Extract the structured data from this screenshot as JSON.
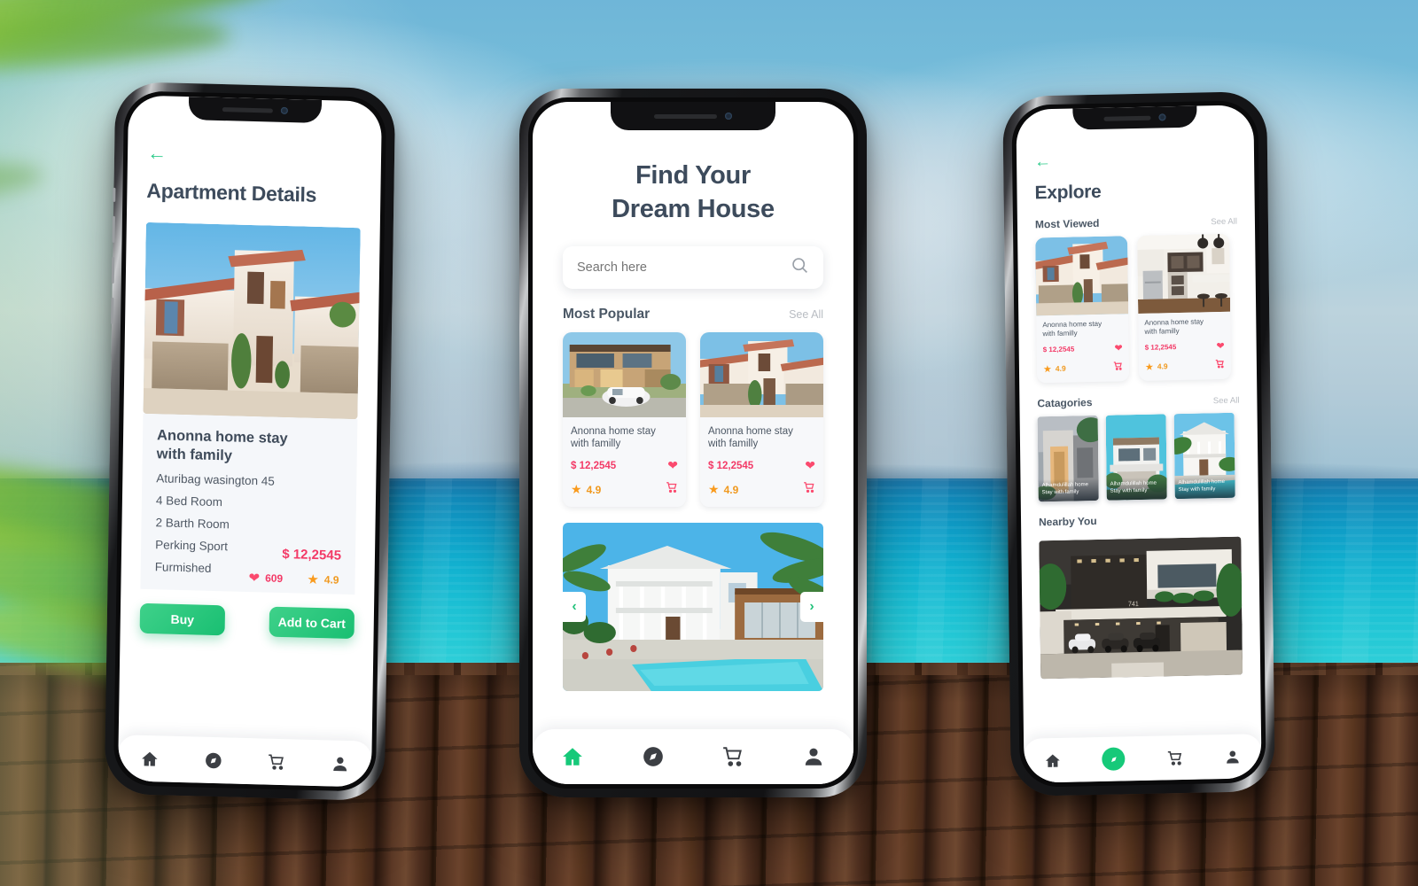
{
  "scene": {
    "background": "beach-deck-photo",
    "colors": {
      "sky": "#8cc5dc",
      "sea": "#12b2d0",
      "deck": "#4b2d1d",
      "accent_green": "#16c979",
      "price_pink": "#f33a67",
      "star_orange": "#f99a1c"
    }
  },
  "phone1": {
    "back_icon": "←",
    "title": "Apartment Details",
    "hero_image": "two-story-spanish-house-with-garages",
    "listing": {
      "name": "Anonna home stay\nwith family",
      "address": "Aturibag wasington 45",
      "features": [
        "4 Bed Room",
        "2 Barth Room",
        "Perking Sport",
        "Furmished"
      ],
      "price": "$ 12,2545",
      "likes": "609",
      "rating": "4.9"
    },
    "buy_label": "Buy",
    "cart_label": "Add to Cart",
    "nav": [
      {
        "icon": "home-icon",
        "active": false
      },
      {
        "icon": "compass-icon",
        "active": false
      },
      {
        "icon": "cart-icon",
        "active": false
      },
      {
        "icon": "person-icon",
        "active": false
      }
    ]
  },
  "phone2": {
    "title_line1": "Find Your",
    "title_line2": "Dream House",
    "search": {
      "placeholder": "Search here",
      "value": "",
      "icon": "search-icon"
    },
    "section": {
      "title": "Most Popular",
      "see_all": "See All"
    },
    "cards": [
      {
        "image": "modern-house-with-white-car",
        "name": "Anonna home stay\nwith familly",
        "price": "$ 12,2545",
        "rating": "4.9",
        "heart_icon": "heart-icon",
        "cart_icon": "cart-icon",
        "star_icon": "star-icon"
      },
      {
        "image": "spanish-house-with-garages",
        "name": "Anonna home stay\nwith familly",
        "price": "$ 12,2545",
        "rating": "4.9",
        "heart_icon": "heart-icon",
        "cart_icon": "cart-icon",
        "star_icon": "star-icon"
      }
    ],
    "carousel": {
      "image": "white-villa-with-pool-and-palms",
      "prev": "‹",
      "next": "›"
    },
    "nav": [
      {
        "icon": "home-icon",
        "active": true
      },
      {
        "icon": "compass-icon",
        "active": false
      },
      {
        "icon": "cart-icon",
        "active": false
      },
      {
        "icon": "person-icon",
        "active": false
      }
    ]
  },
  "phone3": {
    "back_icon": "←",
    "title": "Explore",
    "sections": [
      {
        "title": "Most Viewed",
        "see_all": "See All"
      },
      {
        "title": "Catagories",
        "see_all": "See All"
      },
      {
        "title": "Nearby You",
        "see_all": ""
      }
    ],
    "most_viewed": [
      {
        "image": "spanish-house-exterior",
        "name": "Anonna home stay\nwith familly",
        "price": "$ 12,2545",
        "rating": "4.9"
      },
      {
        "image": "white-kitchen-interior",
        "name": "Anonna home stay\nwith familly",
        "price": "$ 12,2545",
        "rating": "4.9"
      }
    ],
    "categories": [
      {
        "image": "modern-entrance-villa",
        "label": "Alhamdulillah home\nStay with family"
      },
      {
        "image": "white-modern-villa",
        "label": "Alhamdulillah home\nStay with family"
      },
      {
        "image": "colonial-villa-with-pool",
        "label": "Alhamdulillah home\nStay with family"
      }
    ],
    "nearby": {
      "image": "luxury-modern-house-with-cars",
      "badge": "741"
    },
    "nav": [
      {
        "icon": "home-icon",
        "active": false
      },
      {
        "icon": "compass-icon",
        "active": true
      },
      {
        "icon": "cart-icon",
        "active": false
      },
      {
        "icon": "person-icon",
        "active": false
      }
    ]
  }
}
